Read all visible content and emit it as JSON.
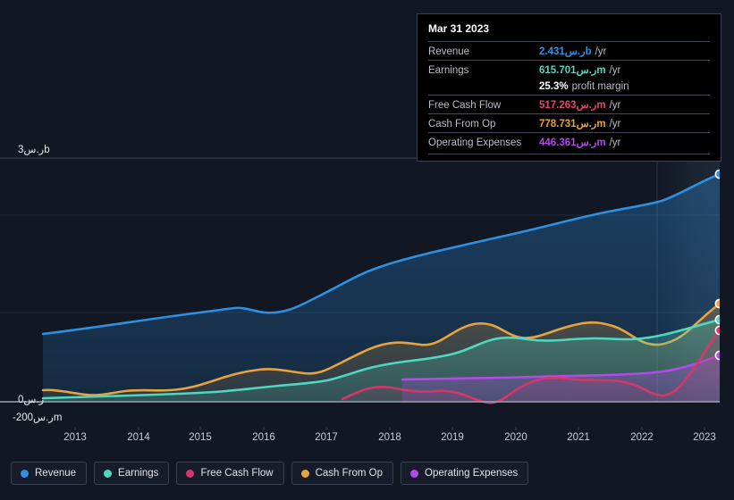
{
  "tooltip": {
    "title": "Mar 31 2023",
    "rows": [
      {
        "label": "Revenue",
        "value": "2.431ر.سb",
        "unit": "/yr",
        "color": "#2f8fe0"
      },
      {
        "label": "Earnings",
        "value": "615.701ر.سm",
        "unit": "/yr",
        "color": "#4fd8c0"
      },
      {
        "label": "",
        "value": "25.3%",
        "unit": "profit margin",
        "color": "#ffffff"
      },
      {
        "label": "Free Cash Flow",
        "value": "517.263ر.سm",
        "unit": "/yr",
        "color": "#e0486f"
      },
      {
        "label": "Cash From Op",
        "value": "778.731ر.سm",
        "unit": "/yr",
        "color": "#e8a33d"
      },
      {
        "label": "Operating Expenses",
        "value": "446.361ر.سm",
        "unit": "/yr",
        "color": "#b44ae8"
      }
    ]
  },
  "axes": {
    "y_top_label": "3ر.سb",
    "y_zero_label": "0ر.س",
    "y_neg_label": "-200ر.سm",
    "x_ticks": [
      "2013",
      "2014",
      "2015",
      "2016",
      "2017",
      "2018",
      "2019",
      "2020",
      "2021",
      "2022",
      "2023"
    ]
  },
  "legend": {
    "items": [
      {
        "label": "Revenue",
        "color": "#2f8fe0"
      },
      {
        "label": "Earnings",
        "color": "#4fd8c0"
      },
      {
        "label": "Free Cash Flow",
        "color": "#d6376a"
      },
      {
        "label": "Cash From Op",
        "color": "#e8a33d"
      },
      {
        "label": "Operating Expenses",
        "color": "#b44ae8"
      }
    ]
  },
  "chart_data": {
    "type": "area",
    "title": "",
    "xlabel": "",
    "ylabel": "",
    "currency": "ر.س",
    "ylim": [
      -200000000,
      3000000000
    ],
    "grid": true,
    "legend_position": "bottom",
    "gridlines": [
      3000000000,
      2000000000,
      1000000000,
      0
    ],
    "x": [
      "2012",
      "2013",
      "2014",
      "2015",
      "2016",
      "2017",
      "2018",
      "2019",
      "2020",
      "2021",
      "2022",
      "2023"
    ],
    "highlight_band": {
      "from": "2022.3",
      "to": "2023.2"
    },
    "series": [
      {
        "name": "Revenue",
        "color": "#2f8fe0",
        "values": [
          0.84,
          0.93,
          1.02,
          1.06,
          1.04,
          1.12,
          1.29,
          1.49,
          1.62,
          1.76,
          1.93,
          2.431
        ],
        "unit": "b"
      },
      {
        "name": "Earnings",
        "color": "#4fd8c0",
        "values": [
          0.021,
          0.032,
          0.041,
          0.055,
          0.088,
          0.186,
          0.31,
          0.395,
          0.42,
          0.43,
          0.475,
          0.6157
        ],
        "unit": "b"
      },
      {
        "name": "Free Cash Flow",
        "color": "#d6376a",
        "values": [
          null,
          null,
          null,
          null,
          null,
          0.012,
          0.055,
          -0.012,
          0.095,
          0.09,
          0.01,
          0.5173
        ],
        "unit": "b"
      },
      {
        "name": "Cash From Op",
        "color": "#e8a33d",
        "values": [
          0.046,
          0.03,
          0.053,
          0.045,
          0.098,
          0.24,
          0.3,
          0.38,
          0.44,
          0.47,
          0.39,
          0.7787
        ],
        "unit": "b"
      },
      {
        "name": "Operating Expenses",
        "color": "#b44ae8",
        "values": [
          null,
          null,
          null,
          null,
          null,
          null,
          0.29,
          0.3,
          0.31,
          0.32,
          0.345,
          0.4464
        ],
        "unit": "b"
      }
    ]
  }
}
